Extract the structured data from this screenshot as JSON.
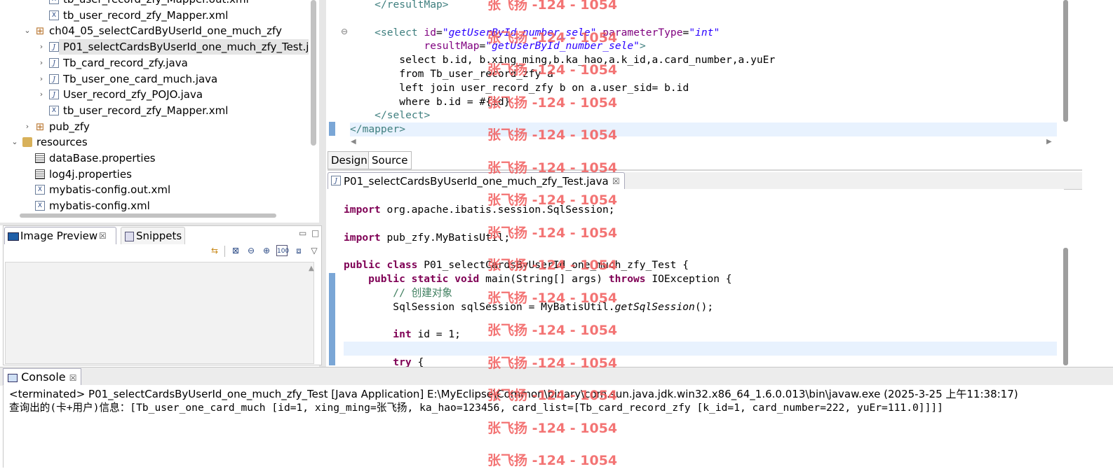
{
  "explorer": {
    "items": [
      {
        "label": "tb_user_record_zfy_Mapper.out.xml",
        "type": "xml",
        "indent": 3,
        "twisty": ""
      },
      {
        "label": "tb_user_record_zfy_Mapper.xml",
        "type": "xml",
        "indent": 3,
        "twisty": ""
      },
      {
        "label": "ch04_05_selectCardByUserId_one_much_zfy",
        "type": "package",
        "indent": 2,
        "twisty": "⌄"
      },
      {
        "label": "P01_selectCardsByUserId_one_much_zfy_Test.j",
        "type": "java",
        "indent": 3,
        "twisty": "›",
        "selected": true
      },
      {
        "label": "Tb_card_record_zfy.java",
        "type": "java",
        "indent": 3,
        "twisty": "›"
      },
      {
        "label": "Tb_user_one_card_much.java",
        "type": "java",
        "indent": 3,
        "twisty": "›"
      },
      {
        "label": "User_record_zfy_POJO.java",
        "type": "java",
        "indent": 3,
        "twisty": "›"
      },
      {
        "label": "tb_user_record_zfy_Mapper.xml",
        "type": "xml",
        "indent": 3,
        "twisty": ""
      },
      {
        "label": "pub_zfy",
        "type": "package",
        "indent": 2,
        "twisty": "›"
      },
      {
        "label": "resources",
        "type": "folder",
        "indent": 1,
        "twisty": "⌄"
      },
      {
        "label": "dataBase.properties",
        "type": "prop",
        "indent": 2,
        "twisty": ""
      },
      {
        "label": "log4j.properties",
        "type": "prop",
        "indent": 2,
        "twisty": ""
      },
      {
        "label": "mybatis-config.out.xml",
        "type": "xml",
        "indent": 2,
        "twisty": ""
      },
      {
        "label": "mybatis-config.xml",
        "type": "xml",
        "indent": 2,
        "twisty": ""
      }
    ]
  },
  "preview": {
    "tabs": [
      {
        "label": "Image Preview",
        "close": "☒",
        "active": true
      },
      {
        "label": "Snippets",
        "active": false
      }
    ]
  },
  "xml_editor": {
    "lines": [
      [
        {
          "t": "    "
        },
        {
          "t": "</resultMap>",
          "c": "tag"
        }
      ],
      [
        {
          "t": ""
        }
      ],
      [
        {
          "t": "    "
        },
        {
          "t": "<select ",
          "c": "tag"
        },
        {
          "t": "id",
          "c": "attr"
        },
        {
          "t": "="
        },
        {
          "t": "\"getUserById_number_sele\"",
          "c": "str"
        },
        {
          "t": " "
        },
        {
          "t": "parameterType",
          "c": "attr"
        },
        {
          "t": "="
        },
        {
          "t": "\"int\"",
          "c": "str"
        }
      ],
      [
        {
          "t": "            "
        },
        {
          "t": "resultMap",
          "c": "attr"
        },
        {
          "t": "="
        },
        {
          "t": "\"getUserById_number_sele\"",
          "c": "str"
        },
        {
          "t": ">",
          "c": "tag"
        }
      ],
      [
        {
          "t": "        select b.id, b.xing_ming,b.ka_hao,a.k_id,a.card_number,a.yuEr"
        }
      ],
      [
        {
          "t": "        from Tb_user_record_zfy a"
        }
      ],
      [
        {
          "t": "        left join user_record_zfy b on a.user_sid= b.id"
        }
      ],
      [
        {
          "t": "        where b.id = #{id}"
        }
      ],
      [
        {
          "t": "    "
        },
        {
          "t": "</select>",
          "c": "tag"
        }
      ],
      [
        {
          "t": "</mapper>",
          "c": "tag"
        }
      ]
    ],
    "tabs": [
      "Design",
      "Source"
    ]
  },
  "java_editor": {
    "tab_title": "P01_selectCardsByUserId_one_much_zfy_Test.java",
    "tab_close": "☒",
    "lines": [
      [
        {
          "t": "import",
          "c": "kw"
        },
        {
          "t": " org.apache.ibatis.session.SqlSession;"
        }
      ],
      [
        {
          "t": ""
        }
      ],
      [
        {
          "t": "import",
          "c": "kw"
        },
        {
          "t": " pub_zfy.MyBatisUtil;"
        }
      ],
      [
        {
          "t": ""
        }
      ],
      [
        {
          "t": "public",
          "c": "kw"
        },
        {
          "t": " "
        },
        {
          "t": "class",
          "c": "kw"
        },
        {
          "t": " P01_selectCardsByUserId_one_much_zfy_Test {"
        }
      ],
      [
        {
          "t": "    "
        },
        {
          "t": "public",
          "c": "kw"
        },
        {
          "t": " "
        },
        {
          "t": "static",
          "c": "kw"
        },
        {
          "t": " "
        },
        {
          "t": "void",
          "c": "kw"
        },
        {
          "t": " main(String[] args) "
        },
        {
          "t": "throws",
          "c": "kw"
        },
        {
          "t": " IOException {"
        }
      ],
      [
        {
          "t": "        "
        },
        {
          "t": "// 创建对象",
          "c": "cmt"
        }
      ],
      [
        {
          "t": "        SqlSession sqlSession = MyBatisUtil."
        },
        {
          "t": "getSqlSession",
          "c": "ital"
        },
        {
          "t": "();"
        }
      ],
      [
        {
          "t": ""
        }
      ],
      [
        {
          "t": "        "
        },
        {
          "t": "int",
          "c": "kw"
        },
        {
          "t": " id = 1;"
        }
      ],
      [
        {
          "t": ""
        }
      ],
      [
        {
          "t": "        "
        },
        {
          "t": "try",
          "c": "kw"
        },
        {
          "t": " {"
        }
      ]
    ]
  },
  "console": {
    "tab_label": "Console",
    "tab_close": "☒",
    "status_line": "<terminated> P01_selectCardsByUserId_one_much_zfy_Test [Java Application] E:\\MyEclipse\\Common\\binary\\com.sun.java.jdk.win32.x86_64_1.6.0.013\\bin\\javaw.exe (2025-3-25 上午11:38:17)",
    "output_line": "查询出的(卡+用户)信息：[Tb_user_one_card_much [id=1, xing_ming=张飞扬, ka_hao=123456, card_list=[Tb_card_record_zfy [k_id=1, card_number=222, yuEr=111.0]]]]"
  },
  "watermark": "张飞扬 -124 - 1054",
  "colors": {
    "keyword": "#7f0055",
    "tag": "#3f7f7f",
    "attr": "#7f007f",
    "string": "#2a00ff",
    "comment": "#3f7f5f",
    "watermark": "#f25c5c"
  }
}
